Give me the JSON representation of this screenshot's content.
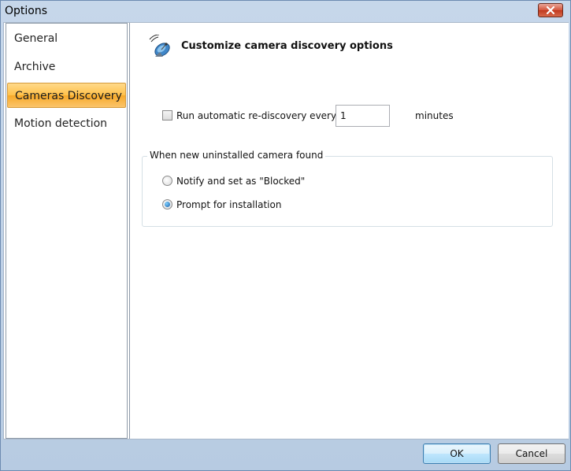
{
  "window": {
    "title": "Options"
  },
  "sidebar": {
    "items": [
      {
        "label": "General",
        "selected": false
      },
      {
        "label": "Archive",
        "selected": false
      },
      {
        "label": "Cameras Discovery",
        "selected": true
      },
      {
        "label": "Motion detection",
        "selected": false
      }
    ]
  },
  "main": {
    "header_title": "Customize camera discovery options",
    "header_icon": "satellite-dish-icon",
    "rediscovery": {
      "checkbox_label": "Run automatic re-discovery every",
      "checked": false,
      "interval_value": "1",
      "unit_label": "minutes"
    },
    "new_camera_group": {
      "title": "When new uninstalled camera found",
      "options": [
        {
          "label": "Notify and set as \"Blocked\"",
          "checked": false
        },
        {
          "label": "Prompt for installation",
          "checked": true
        }
      ]
    }
  },
  "footer": {
    "ok_label": "OK",
    "cancel_label": "Cancel"
  },
  "colors": {
    "selected_item": "#ffc14a",
    "title_bar": "#c6d7ea",
    "close_button": "#d4543a"
  }
}
